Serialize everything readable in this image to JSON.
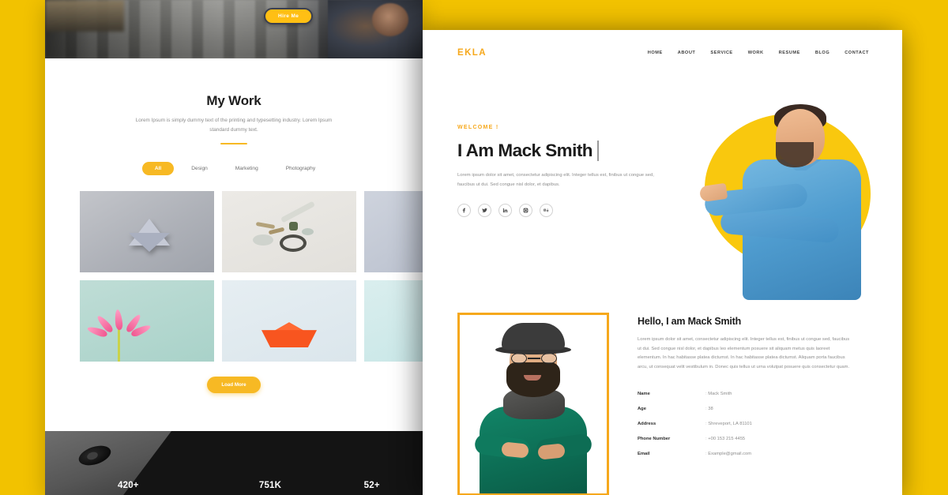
{
  "theme": {
    "brand_yellow": "#F2C200",
    "accent_yellow": "#F7B924",
    "logo_yellow": "#F6A81C",
    "dark": "#141414",
    "text_dark": "#1b1b1b",
    "text_muted": "#8e8e8e"
  },
  "left_panel": {
    "hero": {
      "hire_button": "Hire Me"
    },
    "work": {
      "title": "My Work",
      "subtitle": "Lorem Ipsum is simply dummy text of the printing and typesetting industry. Lorem Ipsum standard dummy text.",
      "filters": [
        {
          "label": "All",
          "active": true
        },
        {
          "label": "Design",
          "active": false
        },
        {
          "label": "Marketing",
          "active": false
        },
        {
          "label": "Photography",
          "active": false
        }
      ],
      "thumbnails": [
        {
          "name": "origami-star-thumbnail"
        },
        {
          "name": "tools-parts-thumbnail"
        },
        {
          "name": "origami-bird-thumbnail"
        },
        {
          "name": "pink-flower-thumbnail"
        },
        {
          "name": "orange-paper-boat-thumbnail"
        },
        {
          "name": "teal-origami-thumbnail"
        }
      ],
      "load_more": "Load More"
    },
    "footer": {
      "stats": [
        {
          "value": "420+"
        },
        {
          "value": "751K"
        },
        {
          "value": "52+"
        }
      ]
    }
  },
  "right_panel": {
    "nav": {
      "logo": "EKLA",
      "links": [
        "HOME",
        "ABOUT",
        "SERVICE",
        "WORK",
        "RESUME",
        "BLOG",
        "CONTACT"
      ]
    },
    "hero": {
      "welcome": "WELCOME !",
      "title": "I Am Mack Smith",
      "description": "Lorem ipsum dolor sit amet, consectetur adipiscing elit. Integer tellus est, finibus ut congue sed, faucibus ut dui. Sed congue nisl dolor, et dapibus.",
      "socials": [
        {
          "name": "facebook-icon"
        },
        {
          "name": "twitter-icon"
        },
        {
          "name": "linkedin-icon"
        },
        {
          "name": "instagram-icon"
        },
        {
          "name": "behance-icon"
        }
      ]
    },
    "about": {
      "title": "Hello, I am Mack Smith",
      "description": "Lorem ipsum dolor sit amet, consectetur adipiscing elit. Integer tellus est, finibus ut congue sed, faucibus ut dui. Sed congue nisl dolor, et dapibus leo elementum posuere sit aliquam metus quis laoreet elementum. In hac habitasse platea dictumst. In hac habitasse platea dictumst. Aliquam porta faucibus arcu, ut consequat velit vestibulum in. Donec quis tellus ut urna volutpat posuere quis consectetur quam.",
      "info": [
        {
          "key": "Name",
          "value": "Mack Smith"
        },
        {
          "key": "Age",
          "value": "38"
        },
        {
          "key": "Address",
          "value": "Shreveport, LA 81101"
        },
        {
          "key": "Phone Number",
          "value": "+00 153 215 4455"
        },
        {
          "key": "Email",
          "value": "Example@gmail.com"
        }
      ]
    }
  }
}
